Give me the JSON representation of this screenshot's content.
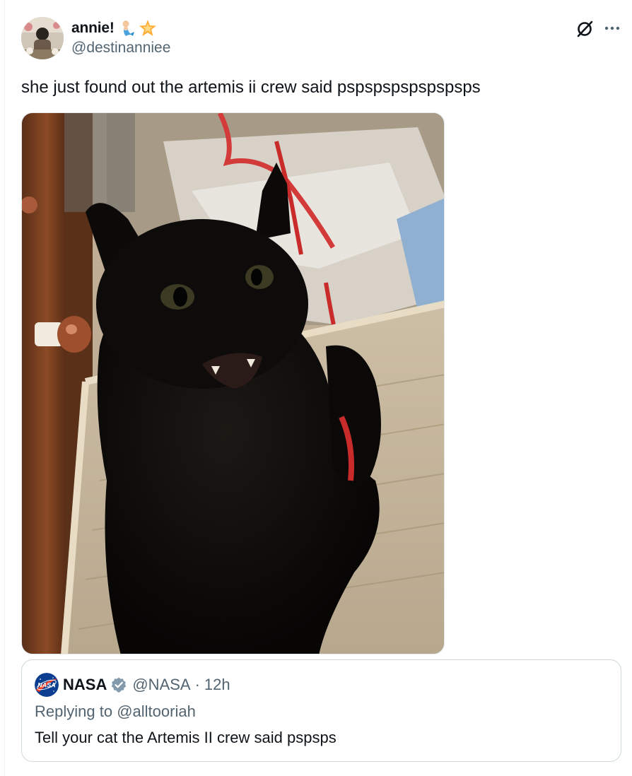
{
  "tweet": {
    "author": {
      "display_name": "annie!",
      "handle": "@destinanniee",
      "name_emojis": [
        "merperson-emoji",
        "glowing-star-emoji"
      ]
    },
    "text": "she just found out the artemis ii crew said pspspspspspspsps",
    "media": {
      "kind": "photo",
      "subject": "black-cat-in-wicker-basket"
    },
    "actions": {
      "grok_icon": "grok-icon",
      "more_icon": "more-icon"
    }
  },
  "quoted_tweet": {
    "author": {
      "display_name": "NASA",
      "handle": "@NASA",
      "verified": true,
      "badge_color": "#829aab"
    },
    "separator": "·",
    "time": "12h",
    "replying_prefix": "Replying to",
    "replying_handle": "@alltooriah",
    "text": "Tell your cat the Artemis II crew said pspsps"
  },
  "colors": {
    "text_primary": "#0f1419",
    "text_secondary": "#536471",
    "border": "#cfd9de",
    "nasa_blue": "#0b3d91",
    "nasa_red": "#fc3d21"
  }
}
